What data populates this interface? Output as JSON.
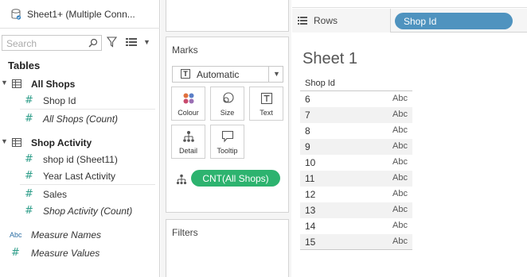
{
  "datasource": {
    "title": "Sheet1+ (Multiple Conn..."
  },
  "search": {
    "placeholder": "Search"
  },
  "data_pane": {
    "heading": "Tables",
    "tables": [
      {
        "name": "All Shops",
        "fields": [
          {
            "label": "Shop Id",
            "italic": false,
            "icon": "hash"
          },
          {
            "label": "All Shops (Count)",
            "italic": true,
            "icon": "hash"
          }
        ]
      },
      {
        "name": "Shop Activity",
        "fields": [
          {
            "label": "shop id (Sheet11)",
            "italic": false,
            "icon": "hash"
          },
          {
            "label": "Year Last Activity",
            "italic": false,
            "icon": "hash"
          },
          {
            "label": "Sales",
            "italic": false,
            "icon": "hash"
          },
          {
            "label": "Shop Activity (Count)",
            "italic": true,
            "icon": "hash"
          }
        ]
      }
    ],
    "measure_names": {
      "badge": "Abc",
      "label": "Measure Names"
    },
    "measure_values": {
      "label": "Measure Values"
    }
  },
  "marks": {
    "title": "Marks",
    "mark_type": "Automatic",
    "mark_type_icon": "T",
    "buttons": [
      {
        "label": "Colour",
        "icon": "colour-icon"
      },
      {
        "label": "Size",
        "icon": "size-icon"
      },
      {
        "label": "Text",
        "icon": "text-icon"
      },
      {
        "label": "Detail",
        "icon": "detail-icon"
      },
      {
        "label": "Tooltip",
        "icon": "tooltip-icon"
      }
    ],
    "pill": "CNT(All Shops)",
    "pill_color": "#2db36f"
  },
  "filters": {
    "title": "Filters"
  },
  "rows_shelf": {
    "label": "Rows",
    "pill": "Shop Id",
    "pill_color": "#4f93bf"
  },
  "sheet": {
    "title": "Sheet 1",
    "header": "Shop Id",
    "rows": [
      {
        "id": "6",
        "val": "Abc"
      },
      {
        "id": "7",
        "val": "Abc"
      },
      {
        "id": "8",
        "val": "Abc"
      },
      {
        "id": "9",
        "val": "Abc"
      },
      {
        "id": "10",
        "val": "Abc"
      },
      {
        "id": "11",
        "val": "Abc"
      },
      {
        "id": "12",
        "val": "Abc"
      },
      {
        "id": "13",
        "val": "Abc"
      },
      {
        "id": "14",
        "val": "Abc"
      },
      {
        "id": "15",
        "val": "Abc"
      }
    ]
  }
}
